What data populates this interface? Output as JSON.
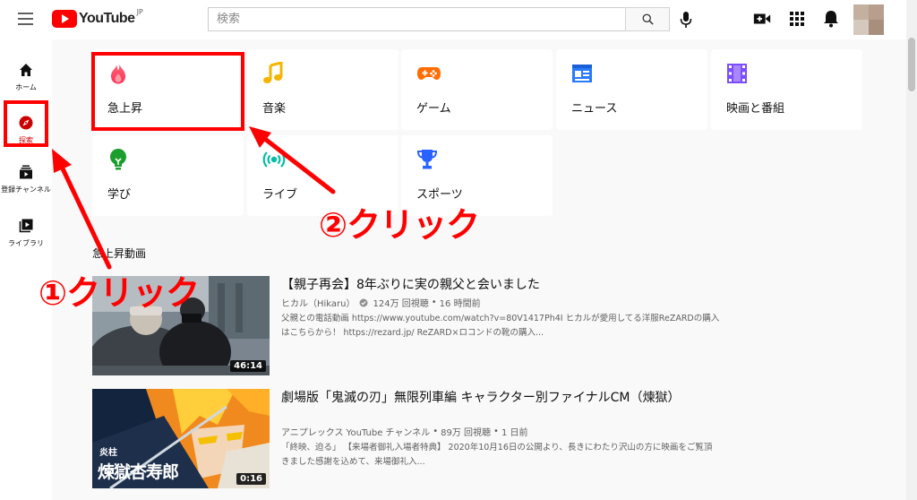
{
  "topbar": {
    "logo_text": "YouTube",
    "logo_region": "JP",
    "search_placeholder": "検索"
  },
  "sidebar": {
    "items": [
      {
        "label": "ホーム",
        "icon": "home-icon"
      },
      {
        "label": "探索",
        "icon": "compass-icon",
        "active": true
      },
      {
        "label": "登録チャンネル",
        "icon": "subscriptions-icon"
      },
      {
        "label": "ライブラリ",
        "icon": "library-icon"
      }
    ]
  },
  "categories": [
    {
      "label": "急上昇",
      "icon": "trending-flame-icon"
    },
    {
      "label": "音楽",
      "icon": "music-note-icon"
    },
    {
      "label": "ゲーム",
      "icon": "gamepad-icon"
    },
    {
      "label": "ニュース",
      "icon": "news-icon"
    },
    {
      "label": "映画と番組",
      "icon": "film-icon"
    },
    {
      "label": "学び",
      "icon": "lightbulb-icon"
    },
    {
      "label": "ライブ",
      "icon": "live-broadcast-icon"
    },
    {
      "label": "スポーツ",
      "icon": "trophy-icon"
    }
  ],
  "section_title": "急上昇動画",
  "videos": [
    {
      "title": "【親子再会】8年ぶりに実の親父と会いました",
      "channel": "ヒカル（Hikaru）",
      "verified": true,
      "views": "124万 回視聴",
      "age": "16 時間前",
      "duration": "46:14",
      "description": "父親との電話動画 https://www.youtube.com/watch?v=80V1417Ph4I ヒカルが愛用してる洋服ReZARDの購入はこちらから！ https://rezard.jp/ ReZARD×ロコンドの靴の購入..."
    },
    {
      "title": "劇場版「鬼滅の刃」無限列車編 キャラクター別ファイナルCM（煉獄）",
      "channel": "アニプレックス YouTube チャンネル",
      "views": "89万 回視聴",
      "age": "1 日前",
      "duration": "0:16",
      "thumb_caption_small": "炎柱",
      "thumb_caption_large": "煉獄杏寿郎",
      "description": "「終映、迫る」 【来場者御礼入場者特典】 2020年10月16日の公開より、長きにわたり沢山の方に映画をご覧頂きました感謝を込めて、来場御礼入..."
    }
  ],
  "annotations": {
    "step1": "①クリック",
    "step2": "②クリック"
  },
  "colors": {
    "accent_red": "#ff0000",
    "active_red": "#cc0000",
    "text_secondary": "#606060"
  }
}
